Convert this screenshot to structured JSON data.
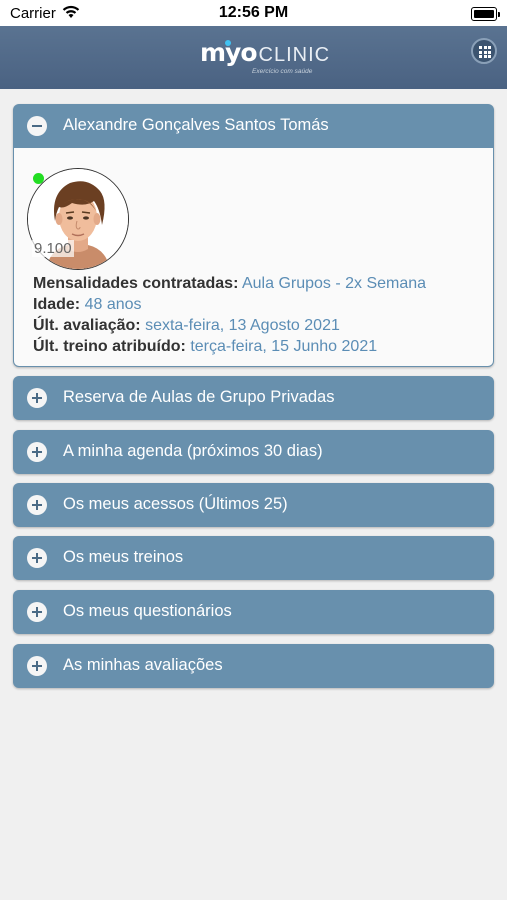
{
  "status_bar": {
    "carrier": "Carrier",
    "time": "12:56 PM"
  },
  "header": {
    "logo_main": "myo",
    "logo_secondary": "CLINIC",
    "logo_tagline": "Exercício com saúde"
  },
  "profile": {
    "name": "Alexandre Gonçalves Santos Tomás",
    "member_number": "9.100",
    "fields": [
      {
        "label": "Mensalidades contratadas:",
        "value": "Aula Grupos - 2x Semana"
      },
      {
        "label": "Idade:",
        "value": "48 anos"
      },
      {
        "label": "Últ. avaliação:",
        "value": "sexta-feira, 13 Agosto 2021"
      },
      {
        "label": "Últ. treino atribuído:",
        "value": "terça-feira, 15 Junho 2021"
      }
    ]
  },
  "sections": [
    {
      "label": "Reserva de Aulas de Grupo Privadas"
    },
    {
      "label": "A minha agenda (próximos 30 dias)"
    },
    {
      "label": "Os meus acessos (Últimos 25)"
    },
    {
      "label": "Os meus treinos"
    },
    {
      "label": "Os meus questionários"
    },
    {
      "label": "As minhas avaliações"
    }
  ],
  "colors": {
    "header": "#4f6886",
    "panel": "#6890ad",
    "value_text": "#5b8db5",
    "online": "#22dd22"
  },
  "icons": {
    "wifi": "wifi-icon",
    "battery": "battery-icon",
    "menu": "grid-menu-icon",
    "collapse": "minus-circle-icon",
    "expand": "plus-circle-icon"
  }
}
